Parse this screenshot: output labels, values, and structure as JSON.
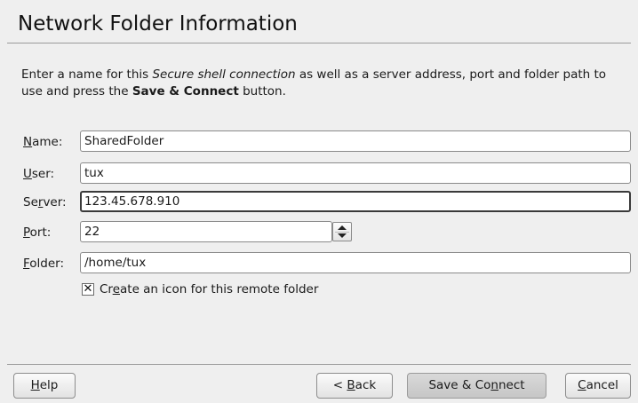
{
  "window": {
    "title": "Network Folder Information"
  },
  "description": {
    "part1": "Enter a name for this ",
    "italic": "Secure shell connection",
    "part2": " as well as a server address, port and folder path to use and press the ",
    "bold": "Save & Connect",
    "part3": " button."
  },
  "form": {
    "name": {
      "label_pre": "",
      "label_u": "N",
      "label_post": "ame:",
      "value": "SharedFolder"
    },
    "user": {
      "label_pre": "",
      "label_u": "U",
      "label_post": "ser:",
      "value": "tux"
    },
    "server": {
      "label_pre": "Se",
      "label_u": "r",
      "label_post": "ver:",
      "value": "123.45.678.910"
    },
    "port": {
      "label_pre": "",
      "label_u": "P",
      "label_post": "ort:",
      "value": "22"
    },
    "folder": {
      "label_pre": "",
      "label_u": "F",
      "label_post": "older:",
      "value": "/home/tux"
    },
    "create_icon": {
      "checked": true,
      "mark": "✕",
      "label_pre": "Cr",
      "label_u": "e",
      "label_post": "ate an icon for this remote folder"
    }
  },
  "buttons": {
    "help": {
      "pre": "",
      "u": "H",
      "post": "elp"
    },
    "back": {
      "pre": "< ",
      "u": "B",
      "post": "ack"
    },
    "save": {
      "pre": "Save & Co",
      "u": "n",
      "post": "nect"
    },
    "cancel": {
      "pre": "",
      "u": "C",
      "post": "ancel"
    }
  }
}
